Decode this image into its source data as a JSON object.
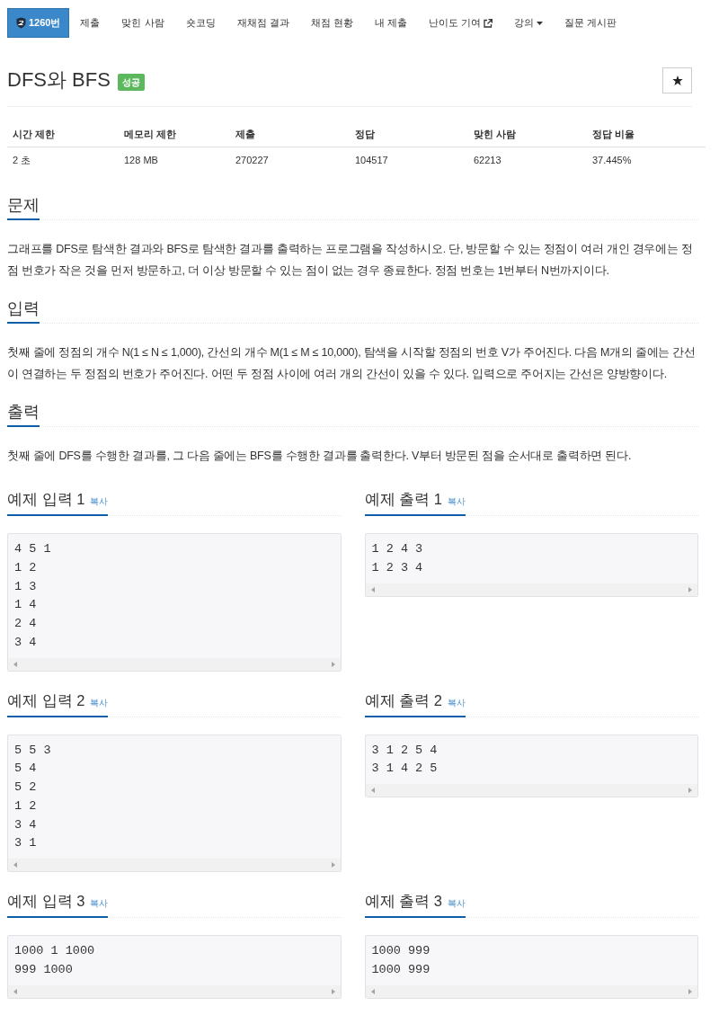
{
  "nav": {
    "items": [
      {
        "label": "1260번",
        "kind": "problem",
        "selected": true
      },
      {
        "label": "제출",
        "kind": "link",
        "selected": false
      },
      {
        "label": "맞힌 사람",
        "kind": "link",
        "selected": false
      },
      {
        "label": "숏코딩",
        "kind": "link",
        "selected": false
      },
      {
        "label": "재채점 결과",
        "kind": "link",
        "selected": false
      },
      {
        "label": "채점 현황",
        "kind": "link",
        "selected": false
      },
      {
        "label": "내 제출",
        "kind": "link",
        "selected": false
      },
      {
        "label": "난이도 기여",
        "kind": "external",
        "selected": false
      },
      {
        "label": "강의",
        "kind": "dropdown",
        "selected": false
      },
      {
        "label": "질문 게시판",
        "kind": "link",
        "selected": false
      }
    ]
  },
  "problem": {
    "title": "DFS와 BFS",
    "status_badge": "성공"
  },
  "info_table": {
    "columns": [
      "시간 제한",
      "메모리 제한",
      "제출",
      "정답",
      "맞힌 사람",
      "정답 비율"
    ],
    "rows": [
      [
        "2 초",
        "128 MB",
        "270227",
        "104517",
        "62213",
        "37.445%"
      ]
    ]
  },
  "sections": [
    {
      "heading": "문제",
      "text": "그래프를 DFS로 탐색한 결과와 BFS로 탐색한 결과를 출력하는 프로그램을 작성하시오. 단, 방문할 수 있는 정점이 여러 개인 경우에는 정점 번호가 작은 것을 먼저 방문하고, 더 이상 방문할 수 있는 점이 없는 경우 종료한다. 정점 번호는 1번부터 N번까지이다."
    },
    {
      "heading": "입력",
      "text": "첫째 줄에 정점의 개수 N(1 ≤ N ≤ 1,000), 간선의 개수 M(1 ≤ M ≤ 10,000), 탐색을 시작할 정점의 번호 V가 주어진다. 다음 M개의 줄에는 간선이 연결하는 두 정점의 번호가 주어진다. 어떤 두 정점 사이에 여러 개의 간선이 있을 수 있다. 입력으로 주어지는 간선은 양방향이다."
    },
    {
      "heading": "출력",
      "text": "첫째 줄에 DFS를 수행한 결과를, 그 다음 줄에는 BFS를 수행한 결과를 출력한다. V부터 방문된 점을 순서대로 출력하면 된다."
    }
  ],
  "samples": [
    {
      "input": {
        "heading": "예제 입력 1",
        "copy_link": "복사",
        "lines": [
          "4 5 1",
          "1 2",
          "1 3",
          "1 4",
          "2 4",
          "3 4"
        ]
      },
      "output": {
        "heading": "예제 출력 1",
        "copy_link": "복사",
        "lines": [
          "1 2 4 3",
          "1 2 3 4"
        ]
      }
    },
    {
      "input": {
        "heading": "예제 입력 2",
        "copy_link": "복사",
        "lines": [
          "5 5 3",
          "5 4",
          "5 2",
          "1 2",
          "3 4",
          "3 1"
        ]
      },
      "output": {
        "heading": "예제 출력 2",
        "copy_link": "복사",
        "lines": [
          "3 1 2 5 4",
          "3 1 4 2 5"
        ]
      }
    },
    {
      "input": {
        "heading": "예제 입력 3",
        "copy_link": "복사",
        "lines": [
          "1000 1 1000",
          "999 1000"
        ]
      },
      "output": {
        "heading": "예제 출력 3",
        "copy_link": "복사",
        "lines": [
          "1000 999",
          "1000 999"
        ]
      }
    }
  ]
}
